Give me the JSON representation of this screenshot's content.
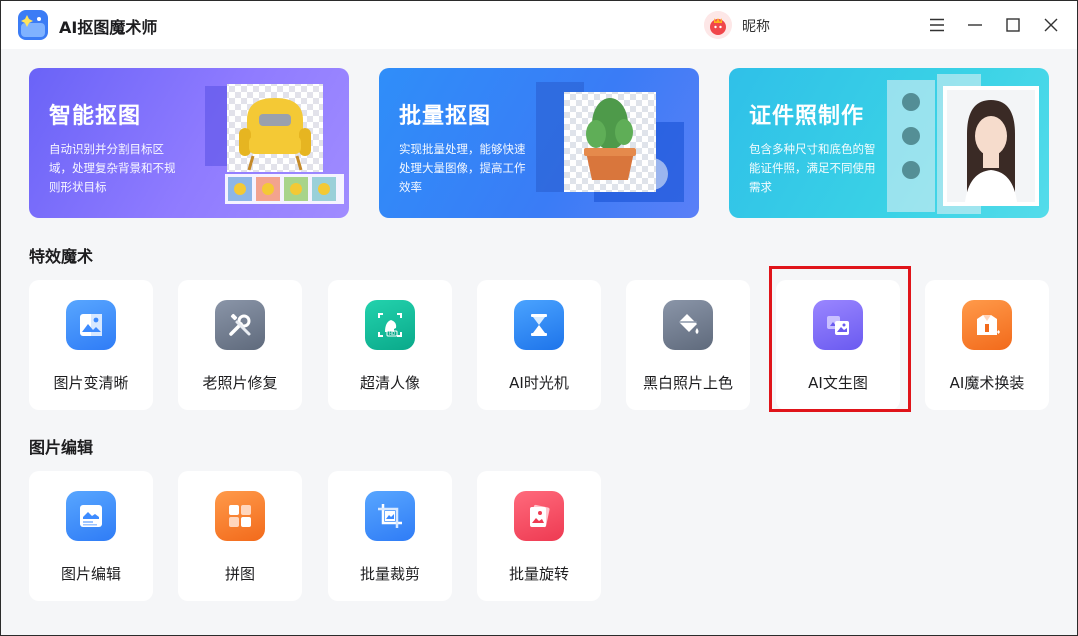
{
  "app": {
    "title": "AI抠图魔术师"
  },
  "user": {
    "nickname": "昵称"
  },
  "banners": [
    {
      "title": "智能抠图",
      "desc": "自动识别并分割目标区域，处理复杂背景和不规则形状目标"
    },
    {
      "title": "批量抠图",
      "desc": "实现批量处理，能够快速处理大量图像，提高工作效率"
    },
    {
      "title": "证件照制作",
      "desc": "包含多种尺寸和底色的智能证件照，满足不同使用需求"
    }
  ],
  "sections": {
    "effects": {
      "title": "特效魔术",
      "items": [
        {
          "label": "图片变清晰",
          "icon": "image-enhance-icon",
          "color": "#3d8bff"
        },
        {
          "label": "老照片修复",
          "icon": "wrench-tools-icon",
          "color": "#6f7a8c"
        },
        {
          "label": "超清人像",
          "icon": "hd-portrait-icon",
          "color": "#10b79c"
        },
        {
          "label": "AI时光机",
          "icon": "hourglass-icon",
          "color": "#2f86f2"
        },
        {
          "label": "黑白照片上色",
          "icon": "paint-bucket-icon",
          "color": "#6f7a8c"
        },
        {
          "label": "AI文生图",
          "icon": "text-to-image-icon",
          "color": "#7c6cf2"
        },
        {
          "label": "AI魔术换装",
          "icon": "outfit-change-icon",
          "color": "#ff7a2e"
        }
      ]
    },
    "editing": {
      "title": "图片编辑",
      "items": [
        {
          "label": "图片编辑",
          "icon": "image-edit-icon",
          "color": "#3d8bff"
        },
        {
          "label": "拼图",
          "icon": "collage-icon",
          "color": "#ff7a2e"
        },
        {
          "label": "批量裁剪",
          "icon": "crop-icon",
          "color": "#3d8bff"
        },
        {
          "label": "批量旋转",
          "icon": "rotate-icon",
          "color": "#f5455c"
        }
      ]
    }
  }
}
